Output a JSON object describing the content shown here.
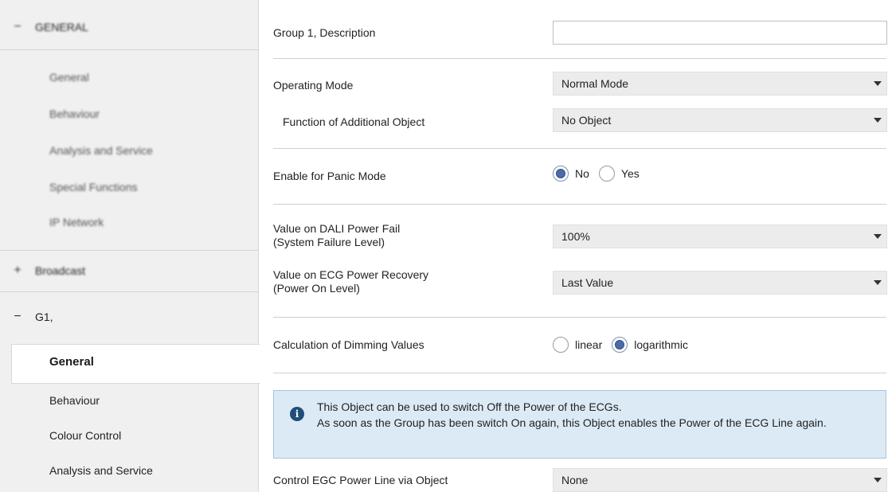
{
  "sidebar": {
    "groups": [
      {
        "toggle": "−",
        "label": "GENERAL",
        "blurred": true
      },
      {
        "toggle": "+",
        "label": "Broadcast",
        "blurred": true
      },
      {
        "toggle": "−",
        "label": "G1,",
        "blurred": false
      }
    ],
    "general_items": [
      "General",
      "Behaviour",
      "Analysis and Service",
      "Special Functions",
      "IP Network"
    ],
    "g1_items": [
      "General",
      "Behaviour",
      "Colour Control",
      "Analysis and Service"
    ],
    "active_item": "General"
  },
  "main": {
    "description": {
      "label": "Group 1, Description",
      "value": ""
    },
    "operating_mode": {
      "label": "Operating Mode",
      "value": "Normal Mode"
    },
    "additional_object": {
      "label": "Function of Additional Object",
      "value": "No Object"
    },
    "panic_mode": {
      "label": "Enable for Panic Mode",
      "options": [
        "No",
        "Yes"
      ],
      "selected": "No"
    },
    "power_fail": {
      "label_line1": "Value on DALI Power Fail",
      "label_line2": "(System Failure Level)",
      "value": "100%"
    },
    "power_recovery": {
      "label_line1": "Value on ECG Power Recovery",
      "label_line2": "(Power On Level)",
      "value": "Last Value"
    },
    "dimming": {
      "label": "Calculation of Dimming Values",
      "options": [
        "linear",
        "logarithmic"
      ],
      "selected": "logarithmic"
    },
    "info": {
      "icon": "info-icon",
      "line1": "This Object can be used to switch Off the Power of the ECGs.",
      "line2": "As soon as the Group has been switch On again, this Object enables the Power of the ECG Line again."
    },
    "power_line": {
      "label": "Control EGC Power Line via Object",
      "value": "None"
    }
  },
  "colors": {
    "info_bg": "#dceaf5",
    "info_border": "#a8c5de",
    "radio_fill": "#4a6ca8",
    "sidebar_bg": "#f0f0f0"
  }
}
